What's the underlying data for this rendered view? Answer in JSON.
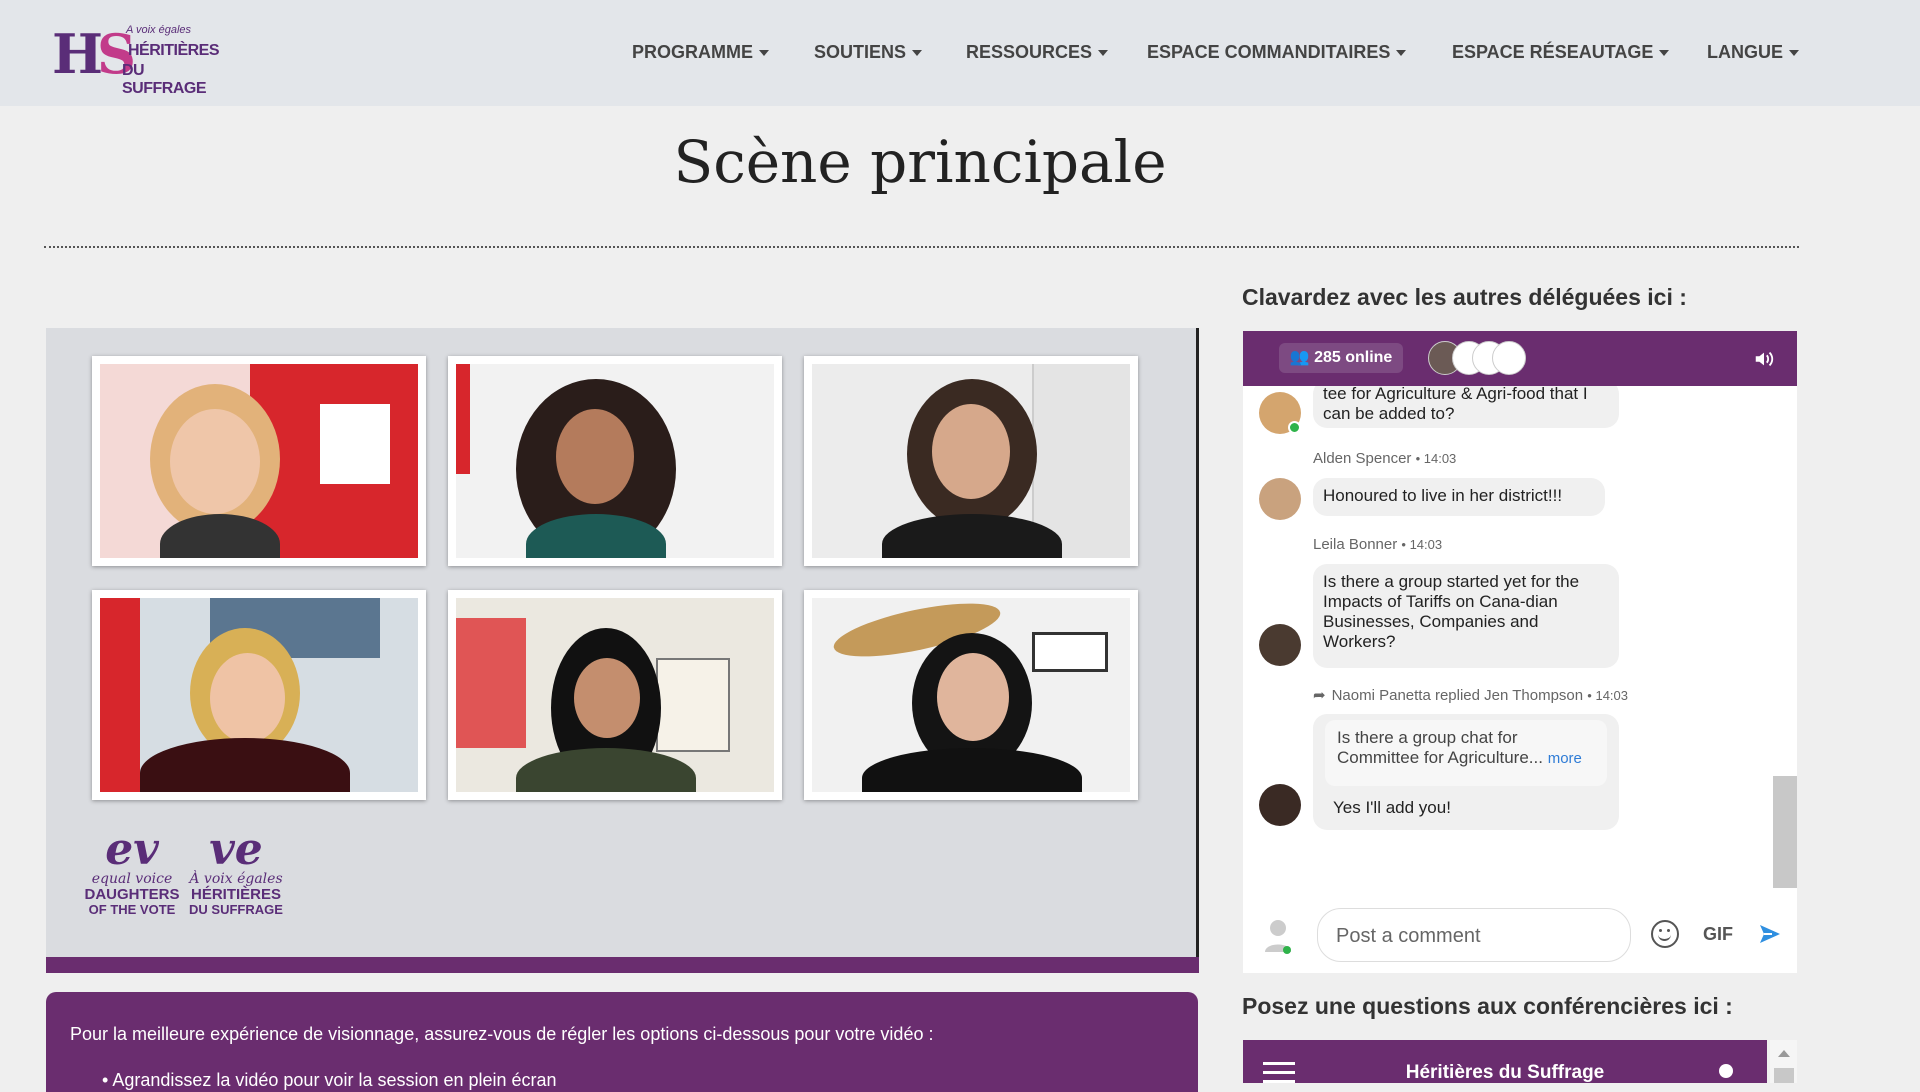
{
  "logo": {
    "letters_left": "H",
    "letters_right": "S",
    "small": "A voix égales",
    "line1": "HÉRITIÈRES",
    "line2": "DU SUFFRAGE"
  },
  "nav": [
    {
      "label": "PROGRAMME"
    },
    {
      "label": "SOUTIENS"
    },
    {
      "label": "RESSOURCES"
    },
    {
      "label": "ESPACE COMMANDITAIRES"
    },
    {
      "label": "ESPACE RÉSEAUTAGE"
    },
    {
      "label": "LANGUE"
    }
  ],
  "page": {
    "title": "Scène principale"
  },
  "video_logo": {
    "left_check": "ev",
    "left_line1": "equal voice",
    "left_line2": "DAUGHTERS",
    "left_line3": "OF THE VOTE",
    "right_check": "ve",
    "right_line1": "À voix égales",
    "right_line2": "HÉRITIÈRES",
    "right_line3": "DU SUFFRAGE"
  },
  "info": {
    "intro": "Pour la meilleure expérience de visionnage, assurez-vous de régler les options ci-dessous pour votre vidéo :",
    "bullet1": "Agrandissez la vidéo pour voir la session en plein écran"
  },
  "chat": {
    "heading": "Clavardez avec les autres déléguées ici :",
    "online": "285 online",
    "messages": [
      {
        "text": "tee for Agriculture & Agri-food that I can be added to?"
      },
      {
        "author": "Alden Spencer",
        "time": "• 14:03",
        "text": "Honoured to live in her district!!!"
      },
      {
        "author": "Leila Bonner",
        "time": "• 14:03",
        "text": "Is there a group started yet for the Impacts of Tariffs on Cana-dian Businesses, Companies and Workers?"
      },
      {
        "author": "Naomi Panetta replied Jen Thompson",
        "time": "• 14:03",
        "quote": "Is there a group chat for Committee for Agriculture...",
        "more": "more",
        "text": "Yes I'll add you!"
      }
    ],
    "input_placeholder": "Post a comment",
    "gif_label": "GIF"
  },
  "questions": {
    "heading": "Posez une questions aux conférencières ici :",
    "bar_title": "Héritières du Suffrage"
  },
  "colors": {
    "brand_purple": "#6a2d6f",
    "online_green": "#2fb34a",
    "link_blue": "#2f7cd6"
  }
}
